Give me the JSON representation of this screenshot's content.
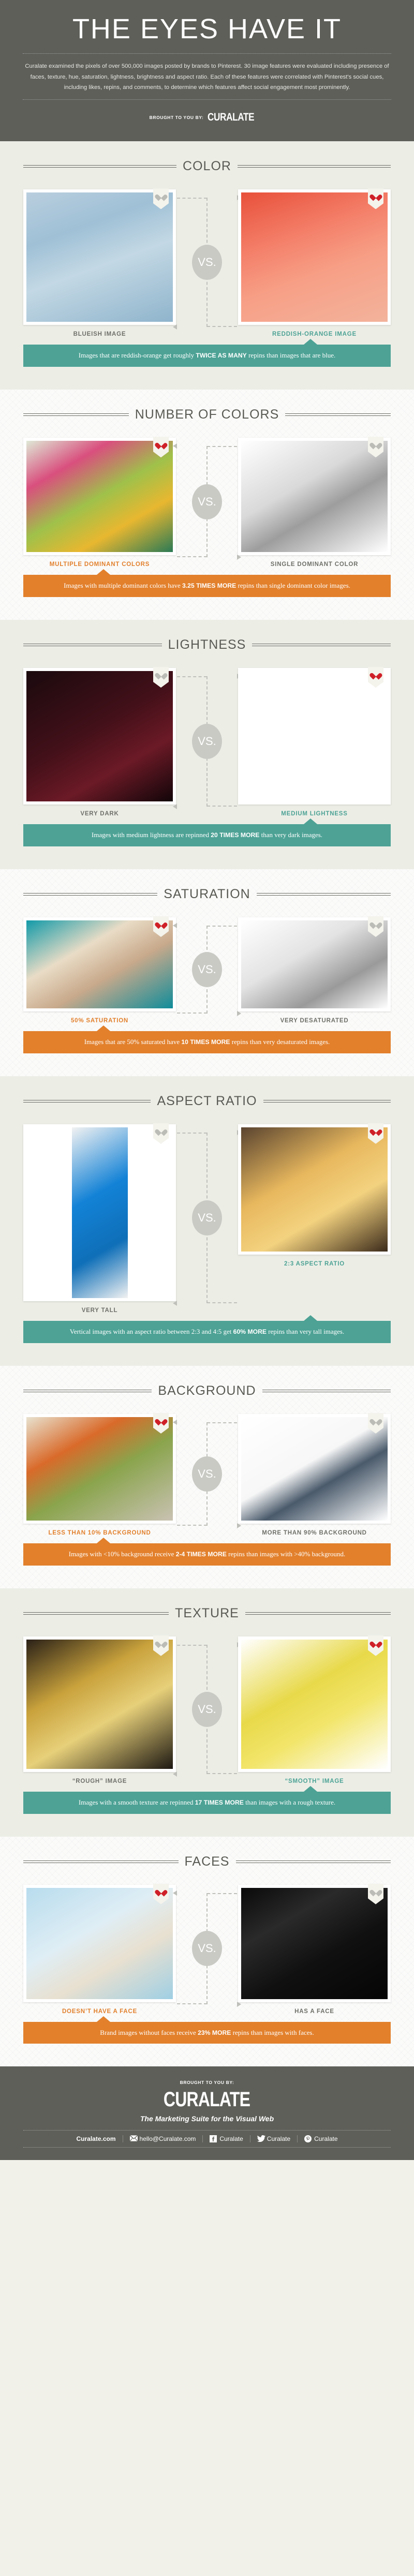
{
  "header": {
    "title": "THE EYES HAVE IT",
    "body": "Curalate examined the pixels of over 500,000 images posted by brands to Pinterest. 30 image features were evaluated including presence of faces, texture, hue, saturation, lightness, brightness and aspect ratio. Each of these features were correlated with Pinterest's social cues, including likes, repins, and comments, to determine which features affect social engagement most prominently.",
    "brought_to_you_by": "BROUGHT TO YOU BY:",
    "brand": "CURALATE"
  },
  "vs_label": "VS.",
  "colors": {
    "teal": "#4da295",
    "orange": "#e2802c",
    "dark_grey": "#5f5f5a",
    "light_bg": "#eceee6",
    "white_bg": "#fbfbfa",
    "heart_red": "#cf2028",
    "heart_grey": "#bcbcb7"
  },
  "sections": [
    {
      "title": "COLOR",
      "background": "light",
      "left": {
        "label": "BLUEISH IMAGE",
        "label_color": "grey",
        "heart": "grey",
        "winner": false
      },
      "right": {
        "label": "REDDISH-ORANGE IMAGE",
        "label_color": "teal",
        "heart": "red",
        "winner": true
      },
      "banner": {
        "color": "teal",
        "winner_side": "right",
        "pre": "Images that are reddish-orange get roughly ",
        "stat": "TWICE AS MANY",
        "post": " repins than images that are blue."
      }
    },
    {
      "title": "NUMBER OF COLORS",
      "background": "white",
      "left": {
        "label": "MULTIPLE DOMINANT COLORS",
        "label_color": "orange",
        "heart": "red",
        "winner": true
      },
      "right": {
        "label": "SINGLE DOMINANT COLOR",
        "label_color": "grey",
        "heart": "grey",
        "winner": false
      },
      "banner": {
        "color": "orange",
        "winner_side": "left",
        "pre": "Images with multiple dominant colors have ",
        "stat": "3.25 TIMES MORE",
        "post": " repins than single dominant color images."
      }
    },
    {
      "title": "LIGHTNESS",
      "background": "light",
      "left": {
        "label": "VERY DARK",
        "label_color": "grey",
        "heart": "grey",
        "winner": false
      },
      "right": {
        "label": "MEDIUM LIGHTNESS",
        "label_color": "teal",
        "heart": "red",
        "winner": true
      },
      "banner": {
        "color": "teal",
        "winner_side": "right",
        "pre": "Images with medium lightness are repinned ",
        "stat": "20 TIMES MORE",
        "post": " than very dark images."
      }
    },
    {
      "title": "SATURATION",
      "background": "white",
      "left": {
        "label": "50% SATURATION",
        "label_color": "orange",
        "heart": "red",
        "winner": true
      },
      "right": {
        "label": "VERY DESATURATED",
        "label_color": "grey",
        "heart": "grey",
        "winner": false
      },
      "banner": {
        "color": "orange",
        "winner_side": "left",
        "pre": "Images that are 50% saturated have ",
        "stat": "10 TIMES MORE",
        "post": " repins than very desaturated images."
      }
    },
    {
      "title": "ASPECT RATIO",
      "background": "light",
      "left": {
        "label": "VERY TALL",
        "label_color": "grey",
        "heart": "grey",
        "winner": false
      },
      "right": {
        "label": "2:3 ASPECT RATIO",
        "label_color": "teal",
        "heart": "red",
        "winner": true
      },
      "banner": {
        "color": "teal",
        "winner_side": "right",
        "pre": "Vertical images with an aspect ratio between 2:3 and 4:5 get ",
        "stat": "60% MORE",
        "post": " repins than very tall images."
      }
    },
    {
      "title": "BACKGROUND",
      "background": "white",
      "left": {
        "label": "LESS THAN 10% BACKGROUND",
        "label_color": "orange",
        "heart": "red",
        "winner": true
      },
      "right": {
        "label": "MORE THAN 90% BACKGROUND",
        "label_color": "grey",
        "heart": "grey",
        "winner": false
      },
      "banner": {
        "color": "orange",
        "winner_side": "left",
        "pre": "Images with <10% background receive ",
        "stat": "2-4 TIMES MORE",
        "post": " repins than images with >40% background."
      }
    },
    {
      "title": "TEXTURE",
      "background": "light",
      "left": {
        "label": "“ROUGH” IMAGE",
        "label_color": "grey",
        "heart": "grey",
        "winner": false
      },
      "right": {
        "label": "“SMOOTH” IMAGE",
        "label_color": "teal",
        "heart": "red",
        "winner": true
      },
      "banner": {
        "color": "teal",
        "winner_side": "right",
        "pre": "Images with a smooth texture are repinned ",
        "stat": "17 TIMES MORE",
        "post": " than images with a rough texture."
      }
    },
    {
      "title": "FACES",
      "background": "white",
      "left": {
        "label": "DOESN’T HAVE A FACE",
        "label_color": "orange",
        "heart": "red",
        "winner": true
      },
      "right": {
        "label": "HAS A FACE",
        "label_color": "grey",
        "heart": "grey",
        "winner": false
      },
      "banner": {
        "color": "orange",
        "winner_side": "left",
        "pre": "Brand images without faces receive ",
        "stat": "23% MORE",
        "post": " repins than images with faces."
      }
    }
  ],
  "footer": {
    "brought_to_you_by": "BROUGHT TO YOU BY:",
    "brand": "CURALATE",
    "tagline": "The Marketing Suite for the Visual Web",
    "links": [
      {
        "icon": "none",
        "text": "Curalate.com"
      },
      {
        "icon": "envelope-icon",
        "text": "hello@Curalate.com"
      },
      {
        "icon": "facebook-icon",
        "text": "Curalate"
      },
      {
        "icon": "twitter-icon",
        "text": "Curalate"
      },
      {
        "icon": "pinterest-icon",
        "text": "Curalate"
      }
    ]
  }
}
